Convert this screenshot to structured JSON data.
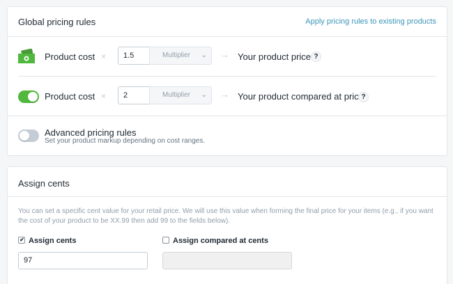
{
  "global_pricing": {
    "title": "Global pricing rules",
    "apply_link": "Apply pricing rules to existing products",
    "price_row": {
      "label": "Product cost",
      "times": "×",
      "multiplier_value": "1.5",
      "select_value": "Multiplier",
      "arrow": "→",
      "target": "Your product price",
      "help": "?"
    },
    "compare_row": {
      "toggle_on": true,
      "label": "Product cost",
      "times": "×",
      "multiplier_value": "2",
      "select_value": "Multiplier",
      "arrow": "→",
      "target": "Your product compared at price",
      "help": "?"
    },
    "advanced": {
      "toggle_on": false,
      "title": "Advanced pricing rules",
      "subtitle": "Set your product markup depending on cost ranges."
    }
  },
  "assign_cents": {
    "title": "Assign cents",
    "description": "You can set a specific cent value for your retail price. We will use this value when forming the final price for your items (e.g., if you want the cost of your product to be XX.99 then add 99 to the fields below).",
    "assign_checkbox": {
      "label": "Assign cents",
      "checked": true,
      "value": "97"
    },
    "compare_checkbox": {
      "label": "Assign compared at cents",
      "checked": false,
      "value": ""
    }
  },
  "colors": {
    "accent_green": "#50b83c",
    "link_blue": "#3b95b8",
    "money_green": "#4a9a3c"
  }
}
